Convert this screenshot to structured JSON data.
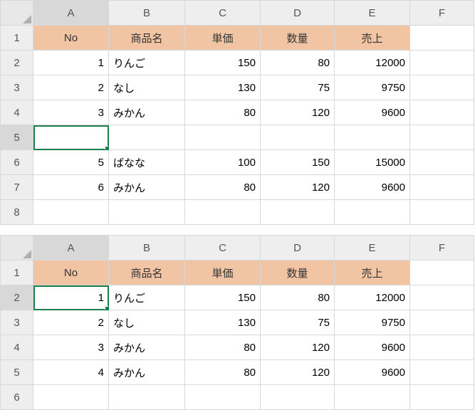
{
  "columns": [
    "A",
    "B",
    "C",
    "D",
    "E",
    "F"
  ],
  "table1": {
    "header_fill": "#f1c5a3",
    "selected_cell": "A5",
    "rows": [
      "1",
      "2",
      "3",
      "4",
      "5",
      "6",
      "7",
      "8"
    ],
    "header": {
      "no": "No",
      "name": "商品名",
      "price": "単価",
      "qty": "数量",
      "sales": "売上"
    },
    "data": [
      {
        "no": 1,
        "name": "りんご",
        "price": 150,
        "qty": 80,
        "sales": 12000
      },
      {
        "no": 2,
        "name": "なし",
        "price": 130,
        "qty": 75,
        "sales": 9750
      },
      {
        "no": 3,
        "name": "みかん",
        "price": 80,
        "qty": 120,
        "sales": 9600
      },
      null,
      {
        "no": 5,
        "name": "ばなな",
        "price": 100,
        "qty": 150,
        "sales": 15000
      },
      {
        "no": 6,
        "name": "みかん",
        "price": 80,
        "qty": 120,
        "sales": 9600
      }
    ]
  },
  "table2": {
    "header_fill": "#f1c5a3",
    "selected_cell": "A2",
    "rows": [
      "1",
      "2",
      "3",
      "4",
      "5",
      "6"
    ],
    "header": {
      "no": "No",
      "name": "商品名",
      "price": "単価",
      "qty": "数量",
      "sales": "売上"
    },
    "data": [
      {
        "no": 1,
        "name": "りんご",
        "price": 150,
        "qty": 80,
        "sales": 12000
      },
      {
        "no": 2,
        "name": "なし",
        "price": 130,
        "qty": 75,
        "sales": 9750
      },
      {
        "no": 3,
        "name": "みかん",
        "price": 80,
        "qty": 120,
        "sales": 9600
      },
      {
        "no": 4,
        "name": "みかん",
        "price": 80,
        "qty": 120,
        "sales": 9600
      }
    ]
  }
}
